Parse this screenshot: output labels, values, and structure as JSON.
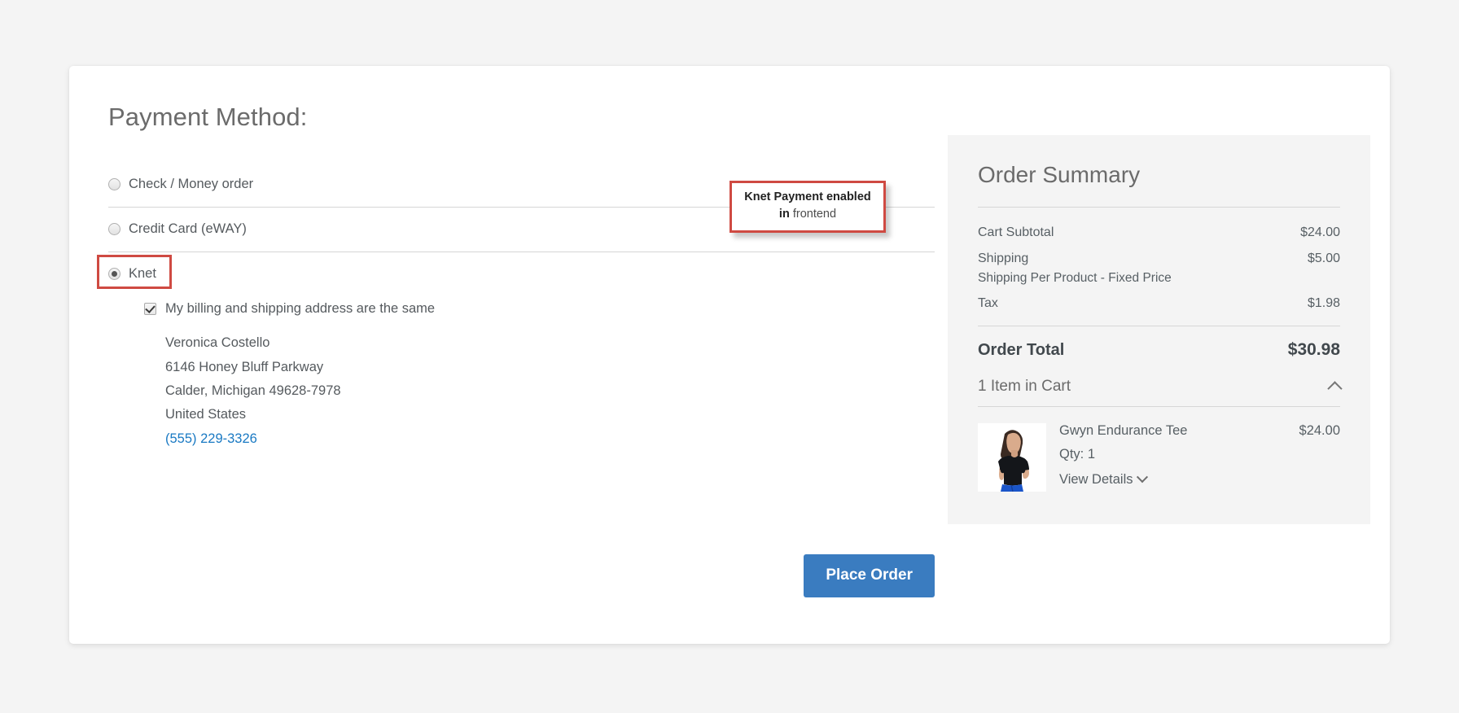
{
  "page": {
    "title": "Payment Method:"
  },
  "payment_methods": [
    {
      "label": "Check / Money order",
      "selected": false
    },
    {
      "label": "Credit Card (eWAY)",
      "selected": false
    },
    {
      "label": "Knet",
      "selected": true
    }
  ],
  "billing": {
    "same_address_label": "My billing and shipping address are the same",
    "same_address_checked": true,
    "address": [
      "Veronica Costello",
      "6146 Honey Bluff Parkway",
      "Calder, Michigan 49628-7978",
      "United States"
    ],
    "phone": "(555) 229-3326"
  },
  "actions": {
    "place_order_label": "Place Order"
  },
  "callout": {
    "line1": "Knet Payment enabled",
    "line2_bold": "in",
    "line2_rest": " frontend",
    "border_color": "#cf4a42"
  },
  "summary": {
    "title": "Order Summary",
    "rows": [
      {
        "label": "Cart Subtotal",
        "value": "$24.00"
      },
      {
        "label": "Shipping",
        "value": "$5.00"
      },
      {
        "label": "Tax",
        "value": "$1.98"
      }
    ],
    "shipping_note": "Shipping Per Product - Fixed Price",
    "order_total_label": "Order Total",
    "order_total_value": "$30.98",
    "cart_toggle_label": "1 Item in Cart",
    "items": [
      {
        "name": "Gwyn Endurance Tee",
        "price": "$24.00",
        "qty_label": "Qty: 1",
        "view_details_label": "View Details"
      }
    ]
  },
  "colors": {
    "primary_button": "#3a7cc0",
    "link": "#1979c3",
    "accent_red": "#cf4a42"
  }
}
